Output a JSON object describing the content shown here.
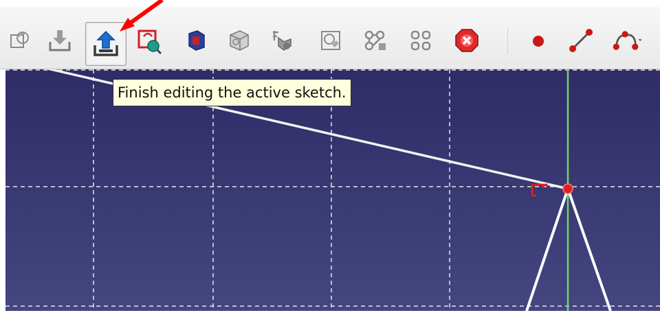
{
  "toolbar": {
    "buttons": [
      {
        "name": "sketch-view-section-icon",
        "active": false
      },
      {
        "name": "attach-sketch-icon",
        "active": false
      },
      {
        "name": "leave-sketch-icon",
        "active": true
      },
      {
        "name": "validate-sketch-icon",
        "active": false
      },
      {
        "name": "mirror-sketch-icon",
        "active": false
      },
      {
        "name": "merge-sketches-icon",
        "active": false
      },
      {
        "name": "sketcher-geometry-icon",
        "active": false
      },
      {
        "name": "view-sketch-icon",
        "active": false
      },
      {
        "name": "clone-icon",
        "active": false
      },
      {
        "name": "array-icon",
        "active": false
      },
      {
        "name": "delete-all-geometry-icon",
        "active": false
      },
      {
        "name": "point-icon",
        "active": false
      },
      {
        "name": "line-icon",
        "active": false
      },
      {
        "name": "arc-icon",
        "active": false
      }
    ]
  },
  "tooltip": {
    "text": "Finish editing the active sketch."
  },
  "colors": {
    "viewport_top": "#2f2c66",
    "viewport_bottom": "#45457f",
    "grid": "#e8e8e8",
    "geometry": "#ffffff",
    "axis_green": "#6fd46f",
    "point_red": "#e02020",
    "annotation_arrow": "#ff0000"
  }
}
